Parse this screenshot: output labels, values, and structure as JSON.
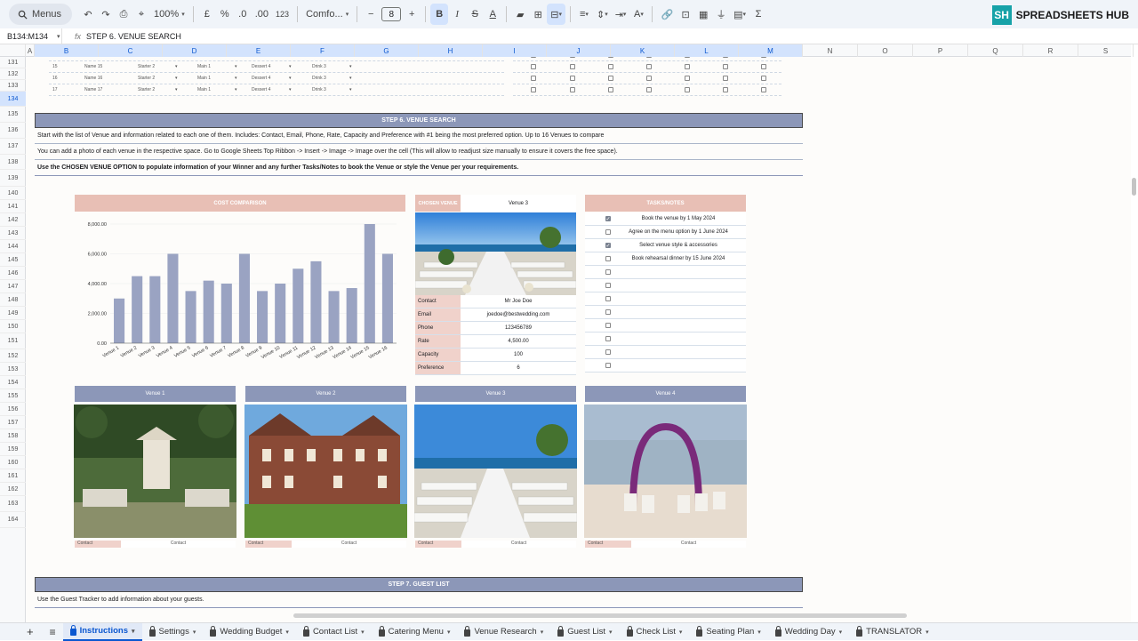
{
  "toolbar": {
    "search_label": "Menus",
    "zoom": "100%",
    "currency": "£",
    "percent": "%",
    "dec_decrease": ".0",
    "dec_increase": ".00",
    "number_format": "123",
    "font": "Comfo...",
    "font_size": "8",
    "bold": "B",
    "italic": "I",
    "strike": "S",
    "text_color": "A"
  },
  "brand": {
    "badge": "SH",
    "name": "SPREADSHEETS HUB"
  },
  "formula_bar": {
    "range": "B134:M134",
    "fx": "fx",
    "value": "STEP 6. VENUE SEARCH"
  },
  "columns": [
    "A",
    "B",
    "C",
    "D",
    "E",
    "F",
    "G",
    "H",
    "I",
    "J",
    "K",
    "L",
    "M",
    "N",
    "O",
    "P",
    "Q",
    "R",
    "S"
  ],
  "rows": [
    "131",
    "132",
    "133",
    "134",
    "135",
    "136",
    "137",
    "138",
    "139",
    "140",
    "141",
    "142",
    "143",
    "144",
    "145",
    "146",
    "147",
    "148",
    "149",
    "150",
    "151",
    "152",
    "153",
    "154",
    "155",
    "156",
    "157",
    "158",
    "159",
    "160",
    "161",
    "162",
    "163",
    "164"
  ],
  "catering_rows": [
    {
      "num": "14",
      "name": "Name 14",
      "starter": "Starter 2",
      "main": "Main 1",
      "dessert": "Dessert 4",
      "drink": "Drink 3"
    },
    {
      "num": "15",
      "name": "Name 15",
      "starter": "Starter 2",
      "main": "Main 1",
      "dessert": "Dessert 4",
      "drink": "Drink 3"
    },
    {
      "num": "16",
      "name": "Name 16",
      "starter": "Starter 2",
      "main": "Main 1",
      "dessert": "Dessert 4",
      "drink": "Drink 3"
    },
    {
      "num": "17",
      "name": "Name 17",
      "starter": "Starter 2",
      "main": "Main 1",
      "dessert": "Dessert 4",
      "drink": "Drink 3"
    }
  ],
  "step6": {
    "title": "STEP 6. VENUE SEARCH",
    "line1": "Start with the list of Venue and information related to each one of them. Includes: Contact, Email, Phone, Rate, Capacity and Preference with #1 being the most preferred option. Up to 16 Venues to compare",
    "line2": "You can add a photo of each venue in the respective space. Go to Google Sheets Top Ribbon -> Insert -> Image -> Image over the cell (This will allow to readjust size manually to ensure it covers the free space).",
    "line3": "Use the CHOSEN VENUE OPTION to populate information of your Winner and any further Tasks/Notes to book the Venue or style the Venue per your requirements."
  },
  "cost_comparison": {
    "title": "COST COMPARISON"
  },
  "chart_data": {
    "type": "bar",
    "title": "COST COMPARISON",
    "categories": [
      "Venue 1",
      "Venue 2",
      "Venue 3",
      "Venue 4",
      "Venue 5",
      "Venue 6",
      "Venue 7",
      "Venue 8",
      "Venue 9",
      "Venue 10",
      "Venue 11",
      "Venue 12",
      "Venue 13",
      "Venue 14",
      "Venue 15",
      "Venue 16"
    ],
    "values": [
      3000,
      4500,
      4500,
      6000,
      3500,
      4200,
      4000,
      6000,
      3500,
      4000,
      5000,
      5500,
      3500,
      3700,
      8000,
      6000
    ],
    "ylim": [
      0,
      8000
    ],
    "yticks": [
      "0.00",
      "2,000.00",
      "4,000.00",
      "6,000.00",
      "8,000.00"
    ],
    "color": "#9aa3c2"
  },
  "chosen_venue": {
    "label": "CHOSEN VENUE",
    "value": "Venue 3",
    "details": [
      {
        "k": "Contact",
        "v": "Mr Joe Doe"
      },
      {
        "k": "Email",
        "v": "joedoe@bestwedding.com"
      },
      {
        "k": "Phone",
        "v": "123456789"
      },
      {
        "k": "Rate",
        "v": "4,500.00"
      },
      {
        "k": "Capacity",
        "v": "100"
      },
      {
        "k": "Preference",
        "v": "6"
      }
    ]
  },
  "tasks": {
    "title": "TASKS/NOTES",
    "items": [
      {
        "text": "Book the venue by 1 May 2024",
        "checked": true
      },
      {
        "text": "Agree on the menu option by 1 June 2024",
        "checked": false
      },
      {
        "text": "Select venue style & accessories",
        "checked": true
      },
      {
        "text": "Book rehearsal dinner by 15 June 2024",
        "checked": false
      },
      {
        "text": "",
        "checked": false
      },
      {
        "text": "",
        "checked": false
      },
      {
        "text": "",
        "checked": false
      },
      {
        "text": "",
        "checked": false
      },
      {
        "text": "",
        "checked": false
      },
      {
        "text": "",
        "checked": false
      },
      {
        "text": "",
        "checked": false
      },
      {
        "text": "",
        "checked": false
      }
    ]
  },
  "venues": [
    {
      "name": "Venue 1",
      "contact_label": "Contact",
      "contact_value": "Contact"
    },
    {
      "name": "Venue 2",
      "contact_label": "Contact",
      "contact_value": "Contact"
    },
    {
      "name": "Venue 3",
      "contact_label": "Contact",
      "contact_value": "Contact"
    },
    {
      "name": "Venue 4",
      "contact_label": "Contact",
      "contact_value": "Contact"
    }
  ],
  "step7": {
    "title": "STEP 7. GUEST LIST",
    "line1": "Use the Guest Tracker to add information about your guests."
  },
  "sheet_tabs": [
    {
      "label": "Instructions",
      "active": true
    },
    {
      "label": "Settings",
      "active": false
    },
    {
      "label": "Wedding Budget",
      "active": false
    },
    {
      "label": "Contact List",
      "active": false
    },
    {
      "label": "Catering Menu",
      "active": false
    },
    {
      "label": "Venue Research",
      "active": false
    },
    {
      "label": "Guest List",
      "active": false
    },
    {
      "label": "Check List",
      "active": false
    },
    {
      "label": "Seating Plan",
      "active": false
    },
    {
      "label": "Wedding Day",
      "active": false
    },
    {
      "label": "TRANSLATOR",
      "active": false
    }
  ]
}
